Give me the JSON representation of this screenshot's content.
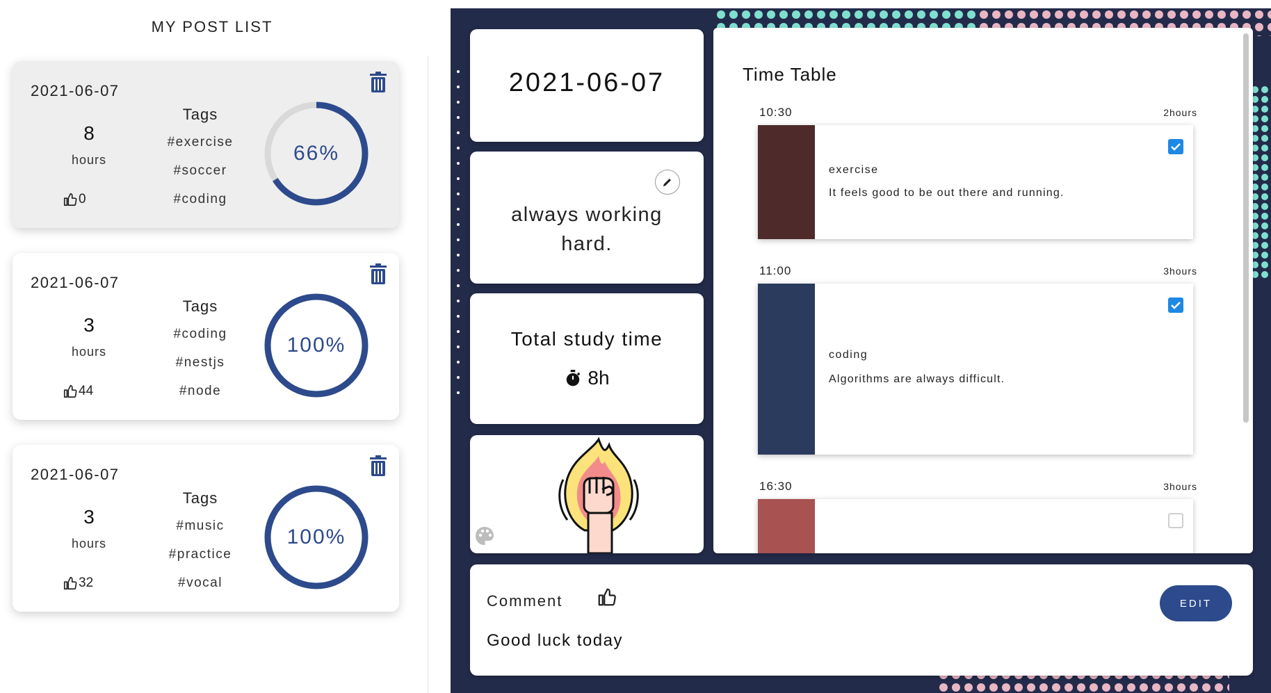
{
  "left": {
    "title": "MY POST LIST",
    "posts": [
      {
        "date": "2021-06-07",
        "hours": "8",
        "hours_label": "hours",
        "likes": "0",
        "tags_title": "Tags",
        "tags": [
          "#exercise",
          "#soccer",
          "#coding"
        ],
        "progress_label": "66%",
        "progress": 0.66,
        "selected": true
      },
      {
        "date": "2021-06-07",
        "hours": "3",
        "hours_label": "hours",
        "likes": "44",
        "tags_title": "Tags",
        "tags": [
          "#coding",
          "#nestjs",
          "#node"
        ],
        "progress_label": "100%",
        "progress": 1.0,
        "selected": false
      },
      {
        "date": "2021-06-07",
        "hours": "3",
        "hours_label": "hours",
        "likes": "32",
        "tags_title": "Tags",
        "tags": [
          "#music",
          "#practice",
          "#vocal"
        ],
        "progress_label": "100%",
        "progress": 1.0,
        "selected": false
      }
    ]
  },
  "detail": {
    "date": "2021-06-07",
    "motto": "always working hard.",
    "study_title": "Total study time",
    "study_time": "8h",
    "timetable": {
      "title": "Time Table",
      "slots": [
        {
          "time": "10:30",
          "duration": "2hours",
          "subject": "exercise",
          "desc": "It feels good to be out there and running.",
          "color": "#4e2a2a",
          "checked": true
        },
        {
          "time": "11:00",
          "duration": "3hours",
          "subject": "coding",
          "desc": "Algorithms are always difficult.",
          "color": "#2b3b5e",
          "checked": true
        },
        {
          "time": "16:30",
          "duration": "3hours",
          "subject": "",
          "desc": "",
          "color": "#a85252",
          "checked": false
        }
      ]
    },
    "comment": {
      "label": "Comment",
      "text": "Good luck today",
      "edit_label": "EDIT"
    }
  },
  "colors": {
    "accent": "#2d4a8c",
    "panel": "#232b4a",
    "checkbox": "#1e88e5"
  },
  "icons": [
    "trash-icon",
    "thumbs-up-icon",
    "pencil-icon",
    "stopwatch-icon",
    "palette-icon",
    "fist-fire-icon"
  ]
}
